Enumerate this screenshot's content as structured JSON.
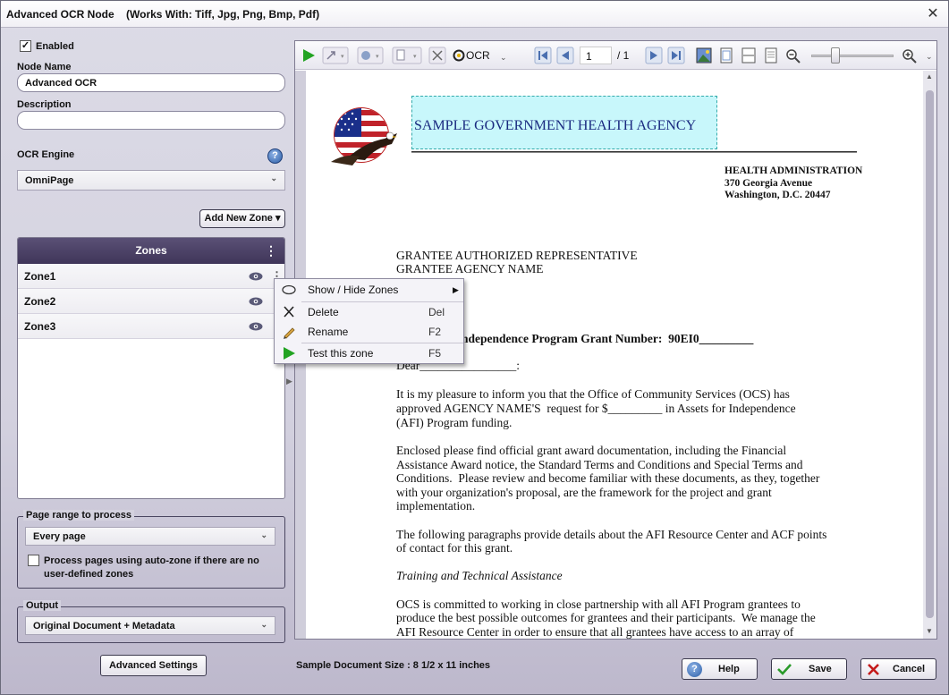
{
  "window": {
    "title": "Advanced OCR Node    (Works With: Tiff, Jpg, Png, Bmp, Pdf)",
    "close_glyph": "✕"
  },
  "left": {
    "enabled_label": "Enabled",
    "enabled_checked": true,
    "node_name_label": "Node Name",
    "node_name_value": "Advanced OCR",
    "description_label": "Description",
    "description_value": "",
    "ocr_engine_label": "OCR Engine",
    "ocr_engine_value": "OmniPage",
    "add_zone_label": "Add New Zone ▾",
    "zones_title": "Zones",
    "zones": [
      {
        "name": "Zone1"
      },
      {
        "name": "Zone2"
      },
      {
        "name": "Zone3"
      }
    ],
    "page_range_title": "Page range to process",
    "page_range_value": "Every page",
    "auto_zone_label": "Process pages using auto-zone if there are no user-defined zones",
    "auto_zone_checked": false,
    "output_title": "Output",
    "output_value": "Original Document + Metadata",
    "advanced_settings_label": "Advanced Settings"
  },
  "context_menu": {
    "items": [
      {
        "label": "Show / Hide Zones",
        "shortcut": "",
        "has_submenu": true,
        "icon": "ellipse-icon"
      },
      {
        "label": "Delete",
        "shortcut": "Del",
        "icon": "x-icon"
      },
      {
        "label": "Rename",
        "shortcut": "F2",
        "icon": "pencil-icon"
      },
      {
        "label": "Test this zone",
        "shortcut": "F5",
        "icon": "play-icon"
      }
    ]
  },
  "toolbar": {
    "ocr_label": "OCR",
    "page_current": "1",
    "page_total": "/ 1"
  },
  "document": {
    "agency_zone_text": "SAMPLE GOVERNMENT HEALTH AGENCY",
    "header_lines": [
      "HEALTH ADMINISTRATION",
      "370 Georgia Avenue",
      "Washington, D.C. 20447"
    ],
    "recipient_lines": [
      "GRANTEE AUTHORIZED REPRESENTATIVE",
      "GRANTEE AGENCY NAME"
    ],
    "grant_line": "ndependence Program Grant Number:  90EI0_________",
    "dear_line": "Dear________________:",
    "para1": [
      "It is my pleasure to inform you that the Office of Community Services (OCS) has",
      "approved AGENCY NAME'S  request for $_________ in Assets for Independence",
      "(AFI) Program funding."
    ],
    "para2": [
      "Enclosed please find official grant award documentation, including the Financial",
      "Assistance Award notice, the Standard Terms and Conditions and Special Terms and",
      "Conditions.  Please review and become familiar with these documents, as they, together",
      "with your organization's proposal, are the framework for the project and grant",
      "implementation."
    ],
    "para3": [
      "The following paragraphs provide details about the AFI Resource Center and ACF points",
      "of contact for this grant."
    ],
    "heading": "Training and Technical Assistance",
    "para4": [
      "OCS is committed to working in close partnership with all AFI Program grantees to",
      "produce the best possible outcomes for grantees and their participants.  We manage the",
      "AFI Resource Center in order to ensure that all grantees have access to an array of"
    ]
  },
  "footer": {
    "doc_size_text": "Sample Document Size : 8 1/2 x 11 inches",
    "help_label": "Help",
    "save_label": "Save",
    "cancel_label": "Cancel"
  },
  "colors": {
    "zones_header": "#4a4068",
    "agency_zone_fill": "#c8f7fb",
    "save_check": "#2a9a2a",
    "cancel_x": "#c41a1a",
    "help_icon": "#2d5fa8"
  }
}
